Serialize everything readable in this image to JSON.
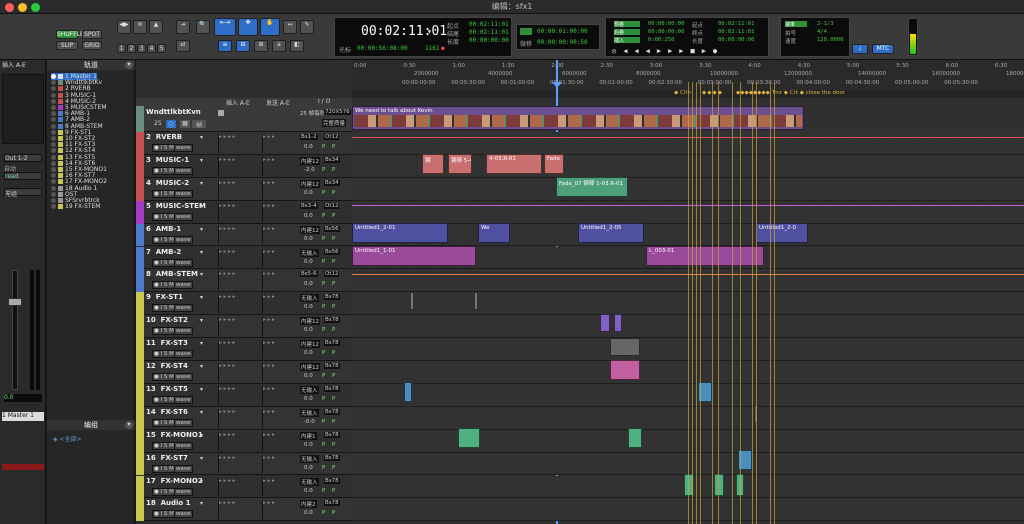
{
  "window": {
    "title": "编辑：sfx1"
  },
  "toolbar": {
    "modes": [
      "SHUFFLE",
      "SPOT",
      "SLIP",
      "GRID"
    ],
    "nums": [
      "1",
      "2",
      "3",
      "4",
      "5"
    ],
    "main_counter": "00:02:11:01",
    "sub_counter": "00:00:56:08:00",
    "sel_labels": [
      "起点",
      "结尾",
      "长度"
    ],
    "sel_values": [
      "00:02:11:01",
      "00:02:11:01",
      "00:00:00:00"
    ],
    "nudge_label": "微移",
    "grid_value": "00:00:01:00:00",
    "nudge_value": "00:00:00:00:50",
    "cursor_label": "光标",
    "cursor_value": "1161",
    "transport_labels": [
      "预卷",
      "后卷",
      "插入"
    ],
    "transport_values": [
      "00:00:00:00",
      "00:00:00:00",
      "0:00:250"
    ],
    "transport_labels2": [
      "起点",
      "终点",
      "长度"
    ],
    "transport_values2": [
      "00:02:11:01",
      "00:02:11:01",
      "00:00:00:00"
    ],
    "meter_labels": [
      "速率",
      "拍号",
      "速度"
    ],
    "meter_values": [
      "2-1/3",
      "4/4",
      "120.0000"
    ],
    "mtc": "MTC"
  },
  "left": {
    "insert_label": "插入 A-E",
    "out_label": "Out 1-2",
    "auto_label": "自动",
    "read_label": "read",
    "none_label": "无组",
    "vol": "0.0",
    "master_num": "1",
    "master_name": "Master 1"
  },
  "tracklist": {
    "title": "轨道",
    "items": [
      "1 Master 1",
      "WndttlkbtKv",
      "2 RVERB",
      "3 MUSIC-1",
      "4 MUSIC-2",
      "5 MUSICSTEM",
      "6 AMB-1",
      "7 AMB-2",
      "8 AMB-STEM",
      "9 FX-ST1",
      "10 FX-ST2",
      "11 FX-ST3",
      "12 FX-ST4",
      "13 FX-ST5",
      "14 FX-ST6",
      "15 FX-MONO1",
      "16 FX-ST7",
      "17 FX-MONO2",
      "18 Audio 1",
      "OST",
      "SFSrvrbtrck",
      "19 FX-STEM"
    ],
    "groups_title": "编组",
    "groups_all": "<全部>"
  },
  "trackhdr": {
    "col_insert": "插入 A-E",
    "col_send": "发送 A-E",
    "col_io": "I / O",
    "video_name": "WndttlkbtKvn",
    "video_fps": "25 帧每秒",
    "video_res": "720X576",
    "video_full": "完整质量",
    "tracks": [
      {
        "num": "2",
        "name": "RVERB",
        "io": "Bs1-2",
        "out": "Ot12",
        "vol": "0.0"
      },
      {
        "num": "3",
        "name": "MUSIC-1",
        "io": "内建12",
        "out": "Bs34",
        "vol": "-2.0"
      },
      {
        "num": "4",
        "name": "MUSIC-2",
        "io": "内建12",
        "out": "Bs34",
        "vol": "0.0"
      },
      {
        "num": "5",
        "name": "MUSIC-STEM",
        "io": "Bs3-4",
        "out": "Ot12",
        "vol": "0.0"
      },
      {
        "num": "6",
        "name": "AMB-1",
        "io": "内建12",
        "out": "Bs56",
        "vol": "0.0"
      },
      {
        "num": "7",
        "name": "AMB-2",
        "io": "无输入",
        "out": "Bs56",
        "vol": "0.0"
      },
      {
        "num": "8",
        "name": "AMB-STEM",
        "io": "Bs5-6",
        "out": "Ot12",
        "vol": "0.0"
      },
      {
        "num": "9",
        "name": "FX-ST1",
        "io": "无输入",
        "out": "Bs78",
        "vol": "0.0"
      },
      {
        "num": "10",
        "name": "FX-ST2",
        "io": "内建12",
        "out": "Bs78",
        "vol": "0.0"
      },
      {
        "num": "11",
        "name": "FX-ST3",
        "io": "内建12",
        "out": "Bs78",
        "vol": "0.0"
      },
      {
        "num": "12",
        "name": "FX-ST4",
        "io": "内建12",
        "out": "Bs78",
        "vol": "0.0"
      },
      {
        "num": "13",
        "name": "FX-ST5",
        "io": "无输入",
        "out": "Bs78",
        "vol": "0.0"
      },
      {
        "num": "14",
        "name": "FX-ST6",
        "io": "无输入",
        "out": "Bs78",
        "vol": "-0.0"
      },
      {
        "num": "15",
        "name": "FX-MONO1",
        "io": "内建1",
        "out": "Bs78",
        "vol": "0.0"
      },
      {
        "num": "16",
        "name": "FX-ST7",
        "io": "无输入",
        "out": "Bs78",
        "vol": "0.0"
      },
      {
        "num": "17",
        "name": "FX-MONO2",
        "io": "无输入",
        "out": "Bs78",
        "vol": "0.0"
      },
      {
        "num": "18",
        "name": "Audio 1",
        "io": "内建2",
        "out": "Bs78",
        "vol": "0.0"
      }
    ]
  },
  "ruler": {
    "rows": [
      "分:秒",
      "采样",
      "时间码",
      "标记"
    ],
    "minsec": [
      "0:00",
      "0:30",
      "1:00",
      "1:30",
      "2:00",
      "2:30",
      "3:00",
      "3:30",
      "4:00",
      "4:30",
      "5:00",
      "5:30",
      "6:00",
      "6:30"
    ],
    "samples": [
      "2000000",
      "4000000",
      "6000000",
      "8000000",
      "10000000",
      "12000000",
      "14000000",
      "16000000",
      "18000000"
    ],
    "markers": [
      "Clth",
      "Trnr",
      "Crt",
      "close the door"
    ]
  },
  "clips": {
    "video_title": "We need to talk about Kevin",
    "music1": [
      "钢",
      "钢琴 5-4",
      "4-03.R-01",
      "Fade"
    ],
    "music2": "Fade_07 钢琴 1-03.R-01",
    "amb1": [
      "Untitled1_2-01",
      "We",
      "Untitled1_2-05",
      "Untitled1_2-0"
    ],
    "amb2": [
      "Untitled1_1-01",
      "L_003-01"
    ],
    "vol_labels": [
      "0 dB",
      "-11.9",
      "-9.4 dB",
      "0 dB",
      "-16.0 dB",
      "+7.8 dB"
    ]
  }
}
